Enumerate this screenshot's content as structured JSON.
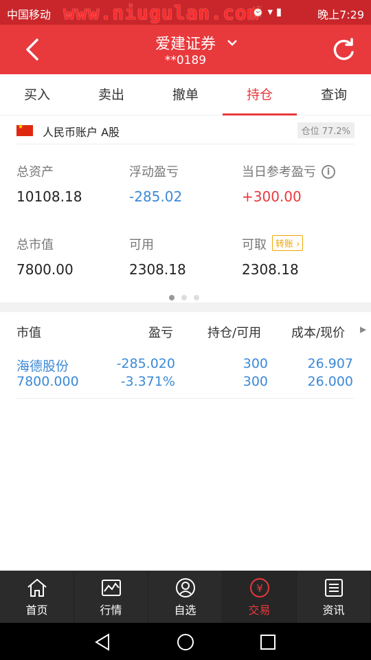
{
  "status_bar": {
    "carrier": "中国移动",
    "watermark": "www.niugulan.com",
    "time": "晚上7:29"
  },
  "header": {
    "title": "爱建证券",
    "account_masked": "**0189"
  },
  "tabs": [
    "买入",
    "卖出",
    "撤单",
    "持仓",
    "查询"
  ],
  "active_tab": "持仓",
  "account": {
    "name": "人民币账户 A股",
    "position_ratio": "仓位 77.2%"
  },
  "summary": {
    "total_assets_label": "总资产",
    "total_assets": "10108.18",
    "float_pl_label": "浮动盈亏",
    "float_pl": "-285.02",
    "today_pl_label": "当日参考盈亏",
    "today_pl": "+300.00",
    "market_value_label": "总市值",
    "market_value": "7800.00",
    "available_label": "可用",
    "available": "2308.18",
    "withdrawable_label": "可取",
    "withdrawable": "2308.18",
    "transfer_label": "转账"
  },
  "table": {
    "headers": [
      "市值",
      "盈亏",
      "持仓/可用",
      "成本/现价"
    ],
    "rows": [
      {
        "name": "海德股份",
        "market_value": "7800.000",
        "pl": "-285.020",
        "pl_pct": "-3.371%",
        "holding": "300",
        "available": "300",
        "cost": "26.907",
        "price": "26.000"
      }
    ]
  },
  "bottom_nav": [
    "首页",
    "行情",
    "自选",
    "交易",
    "资讯"
  ],
  "bottom_nav_active": "交易",
  "colors": {
    "brand": "#e8393d",
    "blue": "#3b89d6"
  }
}
